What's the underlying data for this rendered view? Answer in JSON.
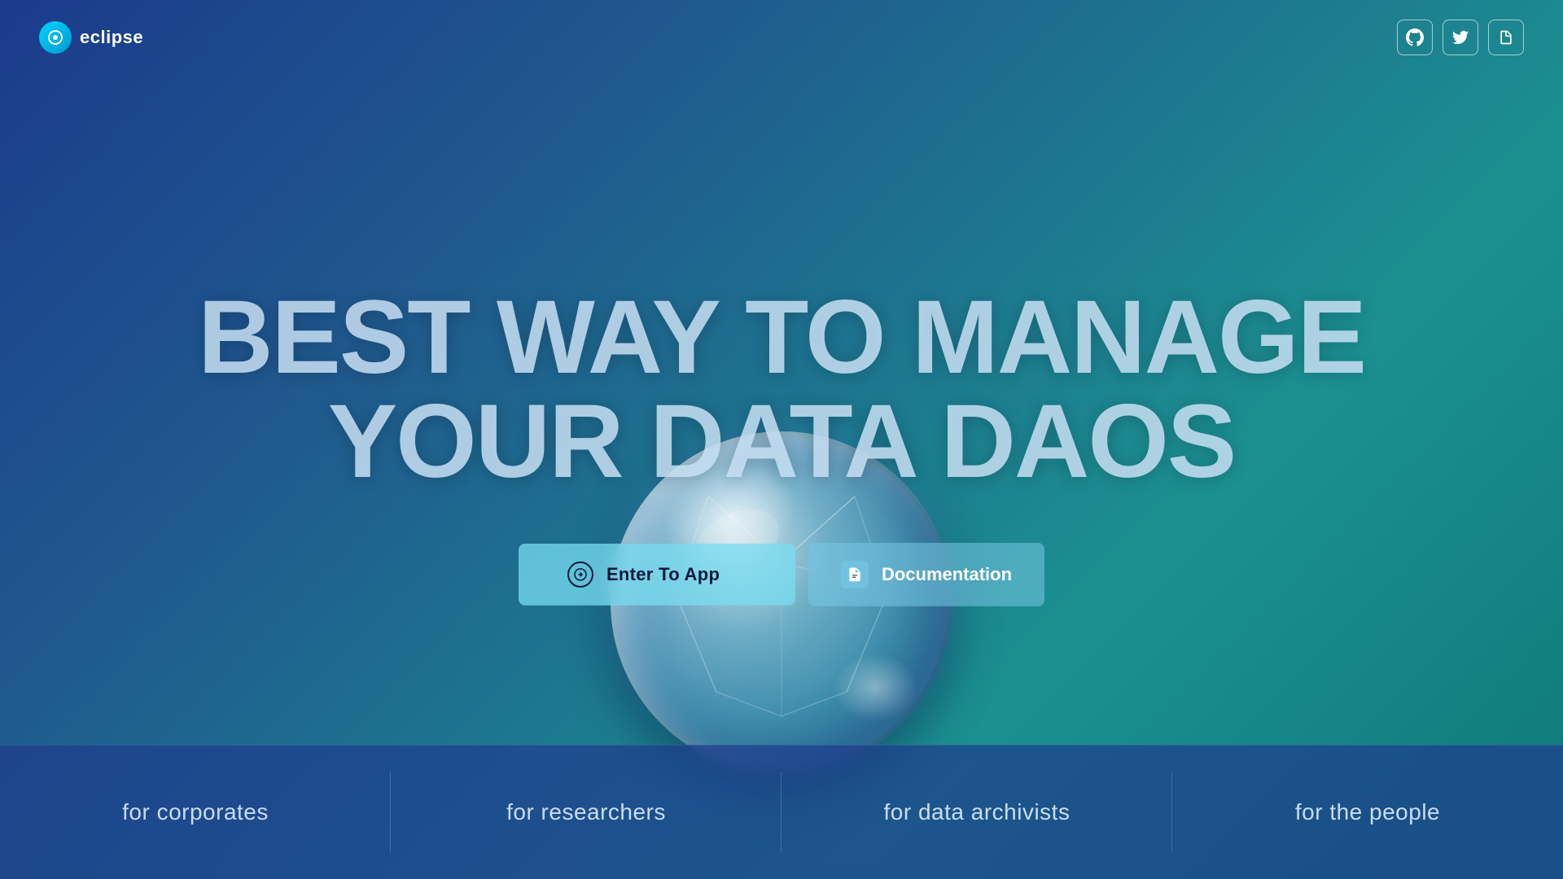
{
  "brand": {
    "logo_text": "eclipse",
    "logo_dot_color": "#00d4ff"
  },
  "header": {
    "github_label": "github",
    "twitter_label": "twitter",
    "docs_label": "docs"
  },
  "hero": {
    "title_line1": "BEST WAY TO MANAGE",
    "title_line2": "YOUR DATA DAOS",
    "enter_app_label": "Enter To App",
    "documentation_label": "Documentation"
  },
  "bottom_bar": {
    "items": [
      {
        "label": "for corporates"
      },
      {
        "label": "for researchers"
      },
      {
        "label": "for data archivists"
      },
      {
        "label": "for the people"
      }
    ]
  }
}
